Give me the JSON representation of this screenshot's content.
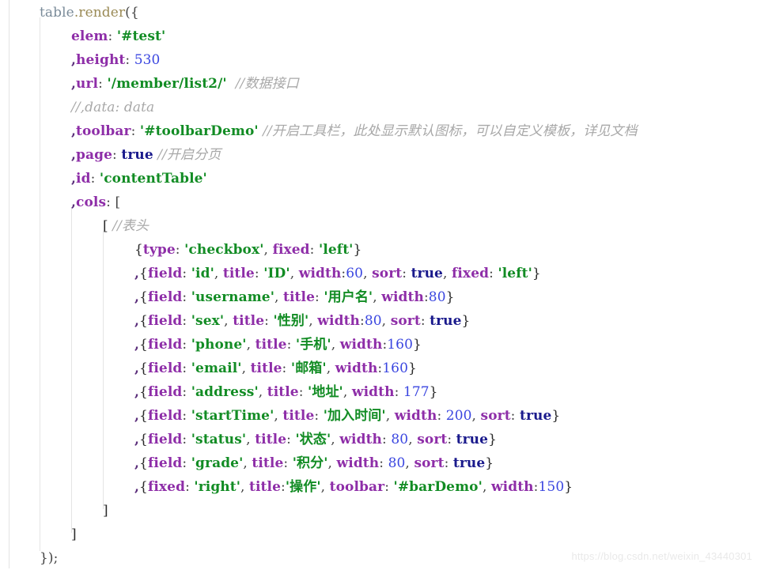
{
  "editor": {
    "background": "#ffffff",
    "language": "javascript",
    "indent_guide_color": "#e4e4e4"
  },
  "theme": {
    "object": "#7a8b99",
    "method": "#9a8a55",
    "punctuation": "#444444",
    "key": "#8e2ea8",
    "string": "#128c24",
    "number": "#3a46e0",
    "boolean": "#1a1a8c",
    "comment": "#a8a8a8"
  },
  "code": {
    "lines": [
      {
        "indent": 0,
        "tokens": [
          {
            "t": "obj",
            "v": "table"
          },
          {
            "t": "method",
            "v": ".render"
          },
          {
            "t": "punct",
            "v": "({"
          }
        ]
      },
      {
        "indent": 1,
        "tokens": [
          {
            "t": "key",
            "v": "elem"
          },
          {
            "t": "punct",
            "v": ": "
          },
          {
            "t": "string",
            "v": "'#test'"
          }
        ]
      },
      {
        "indent": 1,
        "tokens": [
          {
            "t": "comma",
            "v": ","
          },
          {
            "t": "key",
            "v": "height"
          },
          {
            "t": "punct",
            "v": ": "
          },
          {
            "t": "number",
            "v": "530"
          }
        ]
      },
      {
        "indent": 1,
        "tokens": [
          {
            "t": "comma",
            "v": ","
          },
          {
            "t": "key",
            "v": "url"
          },
          {
            "t": "punct",
            "v": ": "
          },
          {
            "t": "string",
            "v": "'/member/list2/'"
          },
          {
            "t": "space",
            "v": "  "
          },
          {
            "t": "comment",
            "v": "//数据接口"
          }
        ]
      },
      {
        "indent": 1,
        "tokens": [
          {
            "t": "comment",
            "v": "//,data: data"
          }
        ]
      },
      {
        "indent": 1,
        "tokens": [
          {
            "t": "comma",
            "v": ","
          },
          {
            "t": "key",
            "v": "toolbar"
          },
          {
            "t": "punct",
            "v": ": "
          },
          {
            "t": "string",
            "v": "'#toolbarDemo'"
          },
          {
            "t": "space",
            "v": " "
          },
          {
            "t": "comment",
            "v": "//开启工具栏，此处显示默认图标，可以自定义模板，详见文档"
          }
        ]
      },
      {
        "indent": 1,
        "tokens": [
          {
            "t": "comma",
            "v": ","
          },
          {
            "t": "key",
            "v": "page"
          },
          {
            "t": "punct",
            "v": ": "
          },
          {
            "t": "bool",
            "v": "true"
          },
          {
            "t": "space",
            "v": " "
          },
          {
            "t": "comment",
            "v": "//开启分页"
          }
        ]
      },
      {
        "indent": 1,
        "tokens": [
          {
            "t": "comma",
            "v": ","
          },
          {
            "t": "key",
            "v": "id"
          },
          {
            "t": "punct",
            "v": ": "
          },
          {
            "t": "string",
            "v": "'contentTable'"
          }
        ]
      },
      {
        "indent": 1,
        "tokens": [
          {
            "t": "comma",
            "v": ","
          },
          {
            "t": "key",
            "v": "cols"
          },
          {
            "t": "punct",
            "v": ": ["
          }
        ]
      },
      {
        "indent": 2,
        "tokens": [
          {
            "t": "bracket",
            "v": "["
          },
          {
            "t": "space",
            "v": " "
          },
          {
            "t": "comment",
            "v": "//表头"
          }
        ]
      },
      {
        "indent": 3,
        "tokens": [
          {
            "t": "bracket",
            "v": "{"
          },
          {
            "t": "key",
            "v": "type"
          },
          {
            "t": "punct",
            "v": ": "
          },
          {
            "t": "string",
            "v": "'checkbox'"
          },
          {
            "t": "punct",
            "v": ", "
          },
          {
            "t": "key",
            "v": "fixed"
          },
          {
            "t": "punct",
            "v": ": "
          },
          {
            "t": "string",
            "v": "'left'"
          },
          {
            "t": "bracket",
            "v": "}"
          }
        ]
      },
      {
        "indent": 3,
        "tokens": [
          {
            "t": "comma",
            "v": ","
          },
          {
            "t": "bracket",
            "v": "{"
          },
          {
            "t": "key",
            "v": "field"
          },
          {
            "t": "punct",
            "v": ": "
          },
          {
            "t": "string",
            "v": "'id'"
          },
          {
            "t": "punct",
            "v": ", "
          },
          {
            "t": "key",
            "v": "title"
          },
          {
            "t": "punct",
            "v": ": "
          },
          {
            "t": "string",
            "v": "'ID'"
          },
          {
            "t": "punct",
            "v": ", "
          },
          {
            "t": "key",
            "v": "width"
          },
          {
            "t": "punct",
            "v": ":"
          },
          {
            "t": "number",
            "v": "60"
          },
          {
            "t": "punct",
            "v": ", "
          },
          {
            "t": "key",
            "v": "sort"
          },
          {
            "t": "punct",
            "v": ": "
          },
          {
            "t": "bool",
            "v": "true"
          },
          {
            "t": "punct",
            "v": ", "
          },
          {
            "t": "key",
            "v": "fixed"
          },
          {
            "t": "punct",
            "v": ": "
          },
          {
            "t": "string",
            "v": "'left'"
          },
          {
            "t": "bracket",
            "v": "}"
          }
        ]
      },
      {
        "indent": 3,
        "tokens": [
          {
            "t": "comma",
            "v": ","
          },
          {
            "t": "bracket",
            "v": "{"
          },
          {
            "t": "key",
            "v": "field"
          },
          {
            "t": "punct",
            "v": ": "
          },
          {
            "t": "string",
            "v": "'username'"
          },
          {
            "t": "punct",
            "v": ", "
          },
          {
            "t": "key",
            "v": "title"
          },
          {
            "t": "punct",
            "v": ": "
          },
          {
            "t": "string",
            "v": "'用户名'"
          },
          {
            "t": "punct",
            "v": ", "
          },
          {
            "t": "key",
            "v": "width"
          },
          {
            "t": "punct",
            "v": ":"
          },
          {
            "t": "number",
            "v": "80"
          },
          {
            "t": "bracket",
            "v": "}"
          }
        ]
      },
      {
        "indent": 3,
        "tokens": [
          {
            "t": "comma",
            "v": ","
          },
          {
            "t": "bracket",
            "v": "{"
          },
          {
            "t": "key",
            "v": "field"
          },
          {
            "t": "punct",
            "v": ": "
          },
          {
            "t": "string",
            "v": "'sex'"
          },
          {
            "t": "punct",
            "v": ", "
          },
          {
            "t": "key",
            "v": "title"
          },
          {
            "t": "punct",
            "v": ": "
          },
          {
            "t": "string",
            "v": "'性别'"
          },
          {
            "t": "punct",
            "v": ", "
          },
          {
            "t": "key",
            "v": "width"
          },
          {
            "t": "punct",
            "v": ":"
          },
          {
            "t": "number",
            "v": "80"
          },
          {
            "t": "punct",
            "v": ", "
          },
          {
            "t": "key",
            "v": "sort"
          },
          {
            "t": "punct",
            "v": ": "
          },
          {
            "t": "bool",
            "v": "true"
          },
          {
            "t": "bracket",
            "v": "}"
          }
        ]
      },
      {
        "indent": 3,
        "tokens": [
          {
            "t": "comma",
            "v": ","
          },
          {
            "t": "bracket",
            "v": "{"
          },
          {
            "t": "key",
            "v": "field"
          },
          {
            "t": "punct",
            "v": ": "
          },
          {
            "t": "string",
            "v": "'phone'"
          },
          {
            "t": "punct",
            "v": ", "
          },
          {
            "t": "key",
            "v": "title"
          },
          {
            "t": "punct",
            "v": ": "
          },
          {
            "t": "string",
            "v": "'手机'"
          },
          {
            "t": "punct",
            "v": ", "
          },
          {
            "t": "key",
            "v": "width"
          },
          {
            "t": "punct",
            "v": ":"
          },
          {
            "t": "number",
            "v": "160"
          },
          {
            "t": "bracket",
            "v": "}"
          }
        ]
      },
      {
        "indent": 3,
        "tokens": [
          {
            "t": "comma",
            "v": ","
          },
          {
            "t": "bracket",
            "v": "{"
          },
          {
            "t": "key",
            "v": "field"
          },
          {
            "t": "punct",
            "v": ": "
          },
          {
            "t": "string",
            "v": "'email'"
          },
          {
            "t": "punct",
            "v": ", "
          },
          {
            "t": "key",
            "v": "title"
          },
          {
            "t": "punct",
            "v": ": "
          },
          {
            "t": "string",
            "v": "'邮箱'"
          },
          {
            "t": "punct",
            "v": ", "
          },
          {
            "t": "key",
            "v": "width"
          },
          {
            "t": "punct",
            "v": ":"
          },
          {
            "t": "number",
            "v": "160"
          },
          {
            "t": "bracket",
            "v": "}"
          }
        ]
      },
      {
        "indent": 3,
        "tokens": [
          {
            "t": "comma",
            "v": ","
          },
          {
            "t": "bracket",
            "v": "{"
          },
          {
            "t": "key",
            "v": "field"
          },
          {
            "t": "punct",
            "v": ": "
          },
          {
            "t": "string",
            "v": "'address'"
          },
          {
            "t": "punct",
            "v": ", "
          },
          {
            "t": "key",
            "v": "title"
          },
          {
            "t": "punct",
            "v": ": "
          },
          {
            "t": "string",
            "v": "'地址'"
          },
          {
            "t": "punct",
            "v": ", "
          },
          {
            "t": "key",
            "v": "width"
          },
          {
            "t": "punct",
            "v": ": "
          },
          {
            "t": "number",
            "v": "177"
          },
          {
            "t": "bracket",
            "v": "}"
          }
        ]
      },
      {
        "indent": 3,
        "tokens": [
          {
            "t": "comma",
            "v": ","
          },
          {
            "t": "bracket",
            "v": "{"
          },
          {
            "t": "key",
            "v": "field"
          },
          {
            "t": "punct",
            "v": ": "
          },
          {
            "t": "string",
            "v": "'startTime'"
          },
          {
            "t": "punct",
            "v": ", "
          },
          {
            "t": "key",
            "v": "title"
          },
          {
            "t": "punct",
            "v": ": "
          },
          {
            "t": "string",
            "v": "'加入时间'"
          },
          {
            "t": "punct",
            "v": ", "
          },
          {
            "t": "key",
            "v": "width"
          },
          {
            "t": "punct",
            "v": ": "
          },
          {
            "t": "number",
            "v": "200"
          },
          {
            "t": "punct",
            "v": ", "
          },
          {
            "t": "key",
            "v": "sort"
          },
          {
            "t": "punct",
            "v": ": "
          },
          {
            "t": "bool",
            "v": "true"
          },
          {
            "t": "bracket",
            "v": "}"
          }
        ]
      },
      {
        "indent": 3,
        "tokens": [
          {
            "t": "comma",
            "v": ","
          },
          {
            "t": "bracket",
            "v": "{"
          },
          {
            "t": "key",
            "v": "field"
          },
          {
            "t": "punct",
            "v": ": "
          },
          {
            "t": "string",
            "v": "'status'"
          },
          {
            "t": "punct",
            "v": ", "
          },
          {
            "t": "key",
            "v": "title"
          },
          {
            "t": "punct",
            "v": ": "
          },
          {
            "t": "string",
            "v": "'状态'"
          },
          {
            "t": "punct",
            "v": ", "
          },
          {
            "t": "key",
            "v": "width"
          },
          {
            "t": "punct",
            "v": ": "
          },
          {
            "t": "number",
            "v": "80"
          },
          {
            "t": "punct",
            "v": ", "
          },
          {
            "t": "key",
            "v": "sort"
          },
          {
            "t": "punct",
            "v": ": "
          },
          {
            "t": "bool",
            "v": "true"
          },
          {
            "t": "bracket",
            "v": "}"
          }
        ]
      },
      {
        "indent": 3,
        "tokens": [
          {
            "t": "comma",
            "v": ","
          },
          {
            "t": "bracket",
            "v": "{"
          },
          {
            "t": "key",
            "v": "field"
          },
          {
            "t": "punct",
            "v": ": "
          },
          {
            "t": "string",
            "v": "'grade'"
          },
          {
            "t": "punct",
            "v": ", "
          },
          {
            "t": "key",
            "v": "title"
          },
          {
            "t": "punct",
            "v": ": "
          },
          {
            "t": "string",
            "v": "'积分'"
          },
          {
            "t": "punct",
            "v": ", "
          },
          {
            "t": "key",
            "v": "width"
          },
          {
            "t": "punct",
            "v": ": "
          },
          {
            "t": "number",
            "v": "80"
          },
          {
            "t": "punct",
            "v": ", "
          },
          {
            "t": "key",
            "v": "sort"
          },
          {
            "t": "punct",
            "v": ": "
          },
          {
            "t": "bool",
            "v": "true"
          },
          {
            "t": "bracket",
            "v": "}"
          }
        ]
      },
      {
        "indent": 3,
        "tokens": [
          {
            "t": "comma",
            "v": ","
          },
          {
            "t": "bracket",
            "v": "{"
          },
          {
            "t": "key",
            "v": "fixed"
          },
          {
            "t": "punct",
            "v": ": "
          },
          {
            "t": "string",
            "v": "'right'"
          },
          {
            "t": "punct",
            "v": ", "
          },
          {
            "t": "key",
            "v": "title"
          },
          {
            "t": "punct",
            "v": ":"
          },
          {
            "t": "string",
            "v": "'操作'"
          },
          {
            "t": "punct",
            "v": ", "
          },
          {
            "t": "key",
            "v": "toolbar"
          },
          {
            "t": "punct",
            "v": ": "
          },
          {
            "t": "string",
            "v": "'#barDemo'"
          },
          {
            "t": "punct",
            "v": ", "
          },
          {
            "t": "key",
            "v": "width"
          },
          {
            "t": "punct",
            "v": ":"
          },
          {
            "t": "number",
            "v": "150"
          },
          {
            "t": "bracket",
            "v": "}"
          }
        ]
      },
      {
        "indent": 2,
        "tokens": [
          {
            "t": "bracket",
            "v": "]"
          }
        ]
      },
      {
        "indent": 1,
        "tokens": [
          {
            "t": "bracket",
            "v": "]"
          }
        ]
      },
      {
        "indent": 0,
        "tokens": [
          {
            "t": "punct",
            "v": "});"
          }
        ]
      }
    ]
  },
  "watermark": {
    "text": "https://blog.csdn.net/weixin_43440301"
  }
}
